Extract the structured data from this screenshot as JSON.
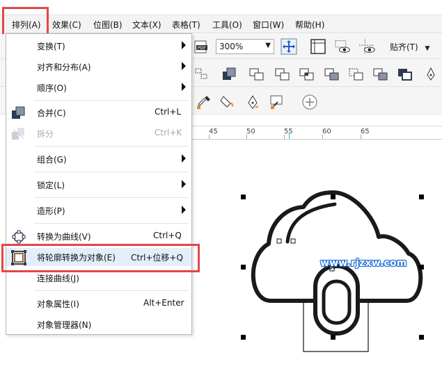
{
  "menubar": {
    "items": [
      {
        "label": "排列(A)"
      },
      {
        "label": "效果(C)"
      },
      {
        "label": "位图(B)"
      },
      {
        "label": "文本(X)"
      },
      {
        "label": "表格(T)"
      },
      {
        "label": "工具(O)"
      },
      {
        "label": "窗口(W)"
      },
      {
        "label": "帮助(H)"
      }
    ]
  },
  "toolbar": {
    "zoom_value": "300%",
    "snap_label": "贴齐(T)"
  },
  "ruler": {
    "ticks": [
      "45",
      "50",
      "55",
      "60",
      "65"
    ]
  },
  "menu": {
    "items": [
      {
        "label": "变换(T)",
        "shortcut": ""
      },
      {
        "label": "对齐和分布(A)",
        "shortcut": ""
      },
      {
        "label": "顺序(O)",
        "shortcut": ""
      },
      {
        "label": "合并(C)",
        "shortcut": "Ctrl+L"
      },
      {
        "label": "拆分",
        "shortcut": "Ctrl+K"
      },
      {
        "label": "组合(G)",
        "shortcut": ""
      },
      {
        "label": "锁定(L)",
        "shortcut": ""
      },
      {
        "label": "造形(P)",
        "shortcut": ""
      },
      {
        "label": "转换为曲线(V)",
        "shortcut": "Ctrl+Q"
      },
      {
        "label": "将轮廓转换为对象(E)",
        "shortcut": "Ctrl+位移+Q"
      },
      {
        "label": "连接曲线(J)",
        "shortcut": ""
      },
      {
        "label": "对象属性(I)",
        "shortcut": "Alt+Enter"
      },
      {
        "label": "对象管理器(N)",
        "shortcut": ""
      }
    ]
  },
  "watermark": "www.rjzxw.com",
  "colors": {
    "highlight_border": "#e34646",
    "menu_hover": "#e4eefb",
    "disabled_text": "#a8a8a8",
    "watermark_outline": "#1a6bd6"
  }
}
